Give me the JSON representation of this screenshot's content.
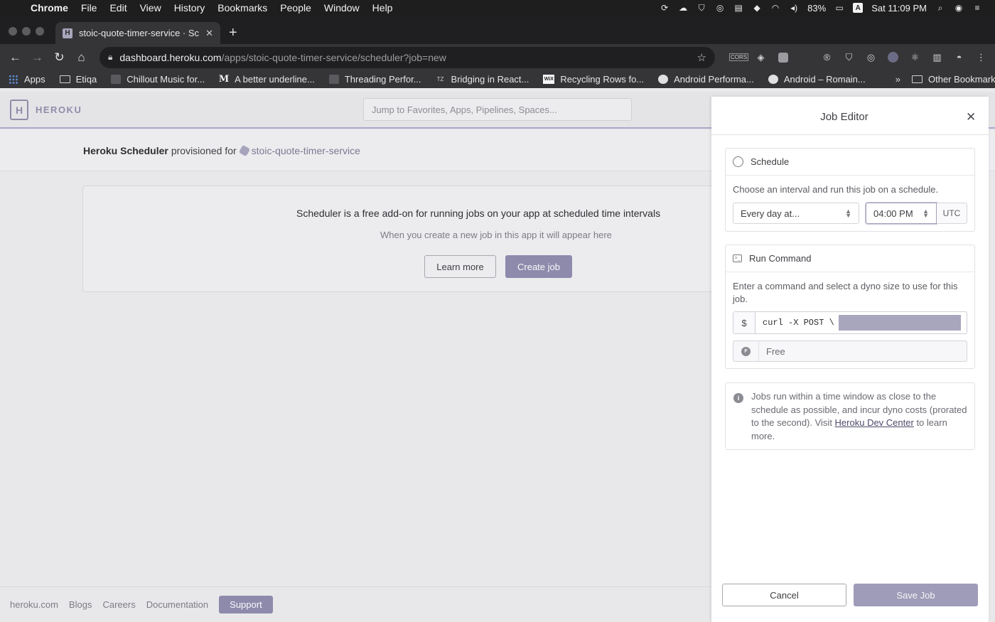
{
  "menubar": {
    "app": "Chrome",
    "items": [
      "File",
      "Edit",
      "View",
      "History",
      "Bookmarks",
      "People",
      "Window",
      "Help"
    ],
    "battery": "83%",
    "input_source": "A",
    "clock": "Sat 11:09 PM"
  },
  "tab": {
    "title": "stoic-quote-timer-service · Sc"
  },
  "toolbar": {
    "url_host": "dashboard.heroku.com",
    "url_path": "/apps/stoic-quote-timer-service/scheduler?job=new"
  },
  "bookmarks": {
    "items": [
      {
        "label": "Apps",
        "icon": "apps-grid-icon"
      },
      {
        "label": "Etiqa",
        "icon": "folder-icon"
      },
      {
        "label": "Chillout Music for...",
        "icon": "video-thumbnail-icon"
      },
      {
        "label": "A better underline...",
        "icon": "medium-icon"
      },
      {
        "label": "Threading Perfor...",
        "icon": "video-thumbnail-icon"
      },
      {
        "label": "Bridging in React...",
        "icon": "tz-icon"
      },
      {
        "label": "Recycling Rows fo...",
        "icon": "wix-icon"
      },
      {
        "label": "Android Performa...",
        "icon": "globe-icon"
      },
      {
        "label": "Android – Romain...",
        "icon": "globe-icon"
      }
    ],
    "more": "»",
    "other": "Other Bookmarks"
  },
  "heroku": {
    "brand": "HEROKU",
    "search_placeholder": "Jump to Favorites, Apps, Pipelines, Spaces...",
    "provisioned_strong": "Heroku Scheduler",
    "provisioned_text": "provisioned for",
    "app_name": "stoic-quote-timer-service",
    "empty_title": "Scheduler is a free add-on for running jobs on your app at scheduled time intervals",
    "empty_sub": "When you create a new job in this app it will appear here",
    "learn_more": "Learn more",
    "create_job": "Create job"
  },
  "footer": {
    "links": [
      "heroku.com",
      "Blogs",
      "Careers",
      "Documentation"
    ],
    "support": "Support"
  },
  "job_editor": {
    "title": "Job Editor",
    "schedule": {
      "heading": "Schedule",
      "description": "Choose an interval and run this job on a schedule.",
      "interval": "Every day at...",
      "time": "04:00 PM",
      "timezone": "UTC"
    },
    "run_command": {
      "heading": "Run Command",
      "description": "Enter a command and select a dyno size to use for this job.",
      "prompt": "$",
      "command": "curl -X POST \\",
      "dyno": "Free"
    },
    "info_text_1": "Jobs run within a time window as close to the schedule as possible, and incur dyno costs (prorated to the second). Visit ",
    "info_link": "Heroku Dev Center",
    "info_text_2": " to learn more.",
    "cancel": "Cancel",
    "save": "Save Job"
  },
  "colors": {
    "accent": "#8d8aac",
    "save_disabled": "#9e9cb8",
    "chrome_dark": "#1f1f21",
    "toolbar": "#353538"
  }
}
